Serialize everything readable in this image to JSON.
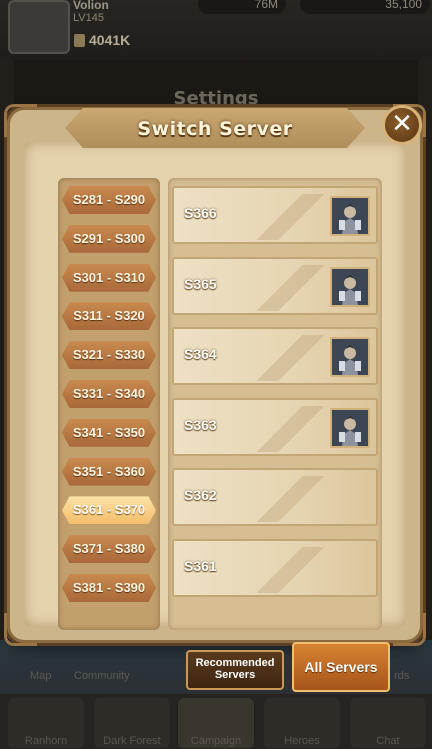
{
  "background": {
    "player_name": "Volion",
    "level": "LV145",
    "power": "4041K",
    "gold": "76M",
    "gems": "35,100",
    "settings_title": "Settings",
    "bottom_labels": [
      "Map",
      "Community",
      "rds"
    ],
    "nav_labels": [
      "Ranhorn",
      "Dark Forest",
      "Campaign",
      "Heroes",
      "Chat"
    ]
  },
  "dialog": {
    "title": "Switch Server",
    "close_icon": "close-icon"
  },
  "ranges": [
    {
      "label": "S281 - S290",
      "active": false
    },
    {
      "label": "S291 - S300",
      "active": false
    },
    {
      "label": "S301 - S310",
      "active": false
    },
    {
      "label": "S311 - S320",
      "active": false
    },
    {
      "label": "S321 - S330",
      "active": false
    },
    {
      "label": "S331 - S340",
      "active": false
    },
    {
      "label": "S341 - S350",
      "active": false
    },
    {
      "label": "S351 - S360",
      "active": false
    },
    {
      "label": "S361 - S370",
      "active": true
    },
    {
      "label": "S371 - S380",
      "active": false
    },
    {
      "label": "S381 - S390",
      "active": false
    }
  ],
  "servers": [
    {
      "name": "S366",
      "has_hero": true
    },
    {
      "name": "S365",
      "has_hero": true
    },
    {
      "name": "S364",
      "has_hero": true
    },
    {
      "name": "S363",
      "has_hero": true
    },
    {
      "name": "S362",
      "has_hero": false
    },
    {
      "name": "S361",
      "has_hero": false
    }
  ],
  "tabs": {
    "recommended": "Recommended Servers",
    "all": "All Servers",
    "active": "all"
  },
  "colors": {
    "range_active": "#f3bd6a",
    "range_default": "#b8743f",
    "tab_active": "#d88331"
  }
}
